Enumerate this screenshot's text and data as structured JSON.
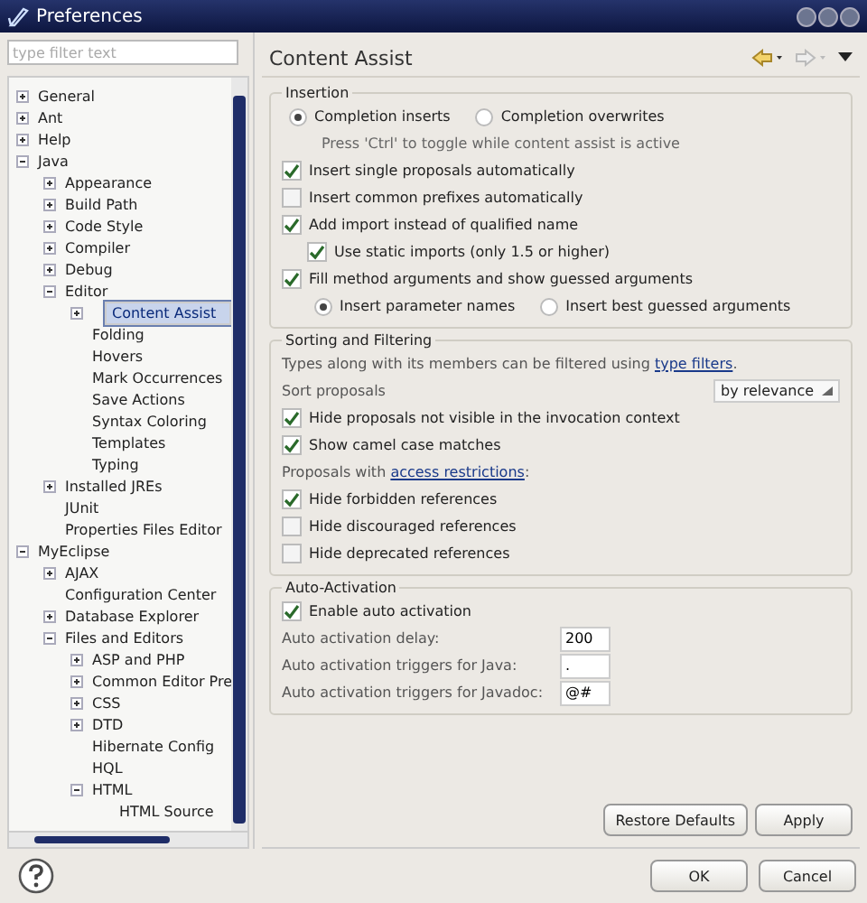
{
  "window": {
    "title": "Preferences"
  },
  "filter": {
    "placeholder": "type filter text"
  },
  "tree": [
    {
      "label": "General",
      "expanded": false,
      "selected": false
    },
    {
      "label": "Ant",
      "expanded": false,
      "selected": false
    },
    {
      "label": "Help",
      "expanded": false,
      "selected": false
    },
    {
      "label": "Java",
      "expanded": true,
      "selected": false,
      "children": [
        {
          "label": "Appearance",
          "expanded": false,
          "selected": false
        },
        {
          "label": "Build Path",
          "expanded": false,
          "selected": false
        },
        {
          "label": "Code Style",
          "expanded": false,
          "selected": false
        },
        {
          "label": "Compiler",
          "expanded": false,
          "selected": false
        },
        {
          "label": "Debug",
          "expanded": false,
          "selected": false
        },
        {
          "label": "Editor",
          "expanded": true,
          "selected": false,
          "children": [
            {
              "label": "Content Assist",
              "expanded": false,
              "selected": true
            },
            {
              "label": "Folding",
              "selected": false
            },
            {
              "label": "Hovers",
              "selected": false
            },
            {
              "label": "Mark Occurrences",
              "selected": false
            },
            {
              "label": "Save Actions",
              "selected": false
            },
            {
              "label": "Syntax Coloring",
              "selected": false
            },
            {
              "label": "Templates",
              "selected": false
            },
            {
              "label": "Typing",
              "selected": false
            }
          ]
        },
        {
          "label": "Installed JREs",
          "expanded": false,
          "selected": false
        },
        {
          "label": "JUnit",
          "selected": false
        },
        {
          "label": "Properties Files Editor",
          "selected": false
        }
      ]
    },
    {
      "label": "MyEclipse",
      "expanded": true,
      "selected": false,
      "children": [
        {
          "label": "AJAX",
          "expanded": false,
          "selected": false
        },
        {
          "label": "Configuration Center",
          "selected": false
        },
        {
          "label": "Database Explorer",
          "expanded": false,
          "selected": false
        },
        {
          "label": "Files and Editors",
          "expanded": true,
          "selected": false,
          "children": [
            {
              "label": "ASP and PHP",
              "expanded": false,
              "selected": false
            },
            {
              "label": "Common Editor Pre",
              "expanded": false,
              "selected": false
            },
            {
              "label": "CSS",
              "expanded": false,
              "selected": false
            },
            {
              "label": "DTD",
              "expanded": false,
              "selected": false
            },
            {
              "label": "Hibernate Config",
              "selected": false
            },
            {
              "label": "HQL",
              "selected": false
            },
            {
              "label": "HTML",
              "expanded": true,
              "selected": false,
              "children": [
                {
                  "label": "HTML Source",
                  "selected": false
                }
              ]
            }
          ]
        }
      ]
    }
  ],
  "page": {
    "title": "Content Assist"
  },
  "groups": [
    {
      "title": "Insertion",
      "items": [
        {
          "kind": "radios",
          "options": [
            {
              "label": "Completion inserts",
              "selected": true
            },
            {
              "label": "Completion overwrites",
              "selected": false
            }
          ]
        },
        {
          "kind": "note",
          "text": "Press 'Ctrl' to toggle while content assist is active"
        },
        {
          "kind": "checkbox",
          "label": "Insert single proposals automatically",
          "checked": true
        },
        {
          "kind": "checkbox",
          "label": "Insert common prefixes automatically",
          "checked": false
        },
        {
          "kind": "checkbox",
          "label": "Add import instead of qualified name",
          "checked": true,
          "children": [
            {
              "kind": "checkbox",
              "label": "Use static imports (only 1.5 or higher)",
              "checked": true
            }
          ]
        },
        {
          "kind": "checkbox",
          "label": "Fill method arguments and show guessed arguments",
          "checked": true,
          "children": [
            {
              "kind": "radios",
              "options": [
                {
                  "label": "Insert parameter names",
                  "selected": true
                },
                {
                  "label": "Insert best guessed arguments",
                  "selected": false
                }
              ]
            }
          ]
        }
      ]
    },
    {
      "title": "Sorting and Filtering",
      "items": [
        {
          "kind": "link_note",
          "text": "Types along with its members can be filtered using ",
          "link": "type filters",
          "tail": "."
        },
        {
          "kind": "select",
          "label": "Sort proposals",
          "value": "by relevance"
        },
        {
          "kind": "checkbox",
          "label": "Hide proposals not visible in the invocation context",
          "checked": true
        },
        {
          "kind": "checkbox",
          "label": "Show camel case matches",
          "checked": true
        },
        {
          "kind": "link_note",
          "text": "Proposals with ",
          "link": "access restrictions",
          "tail": ":"
        },
        {
          "kind": "checkbox",
          "label": "Hide forbidden references",
          "checked": true
        },
        {
          "kind": "checkbox",
          "label": "Hide discouraged references",
          "checked": false
        },
        {
          "kind": "checkbox",
          "label": "Hide deprecated references",
          "checked": false
        }
      ]
    },
    {
      "title": "Auto-Activation",
      "items": [
        {
          "kind": "checkbox",
          "label": "Enable auto activation",
          "checked": true
        },
        {
          "kind": "field",
          "label": "Auto activation delay:",
          "value": "200"
        },
        {
          "kind": "field",
          "label": "Auto activation triggers for Java:",
          "value": "."
        },
        {
          "kind": "field",
          "label": "Auto activation triggers for Javadoc:",
          "value": "@#"
        }
      ]
    }
  ],
  "page_buttons": [
    "Restore Defaults",
    "Apply"
  ],
  "dialog_buttons": [
    "OK",
    "Cancel"
  ]
}
